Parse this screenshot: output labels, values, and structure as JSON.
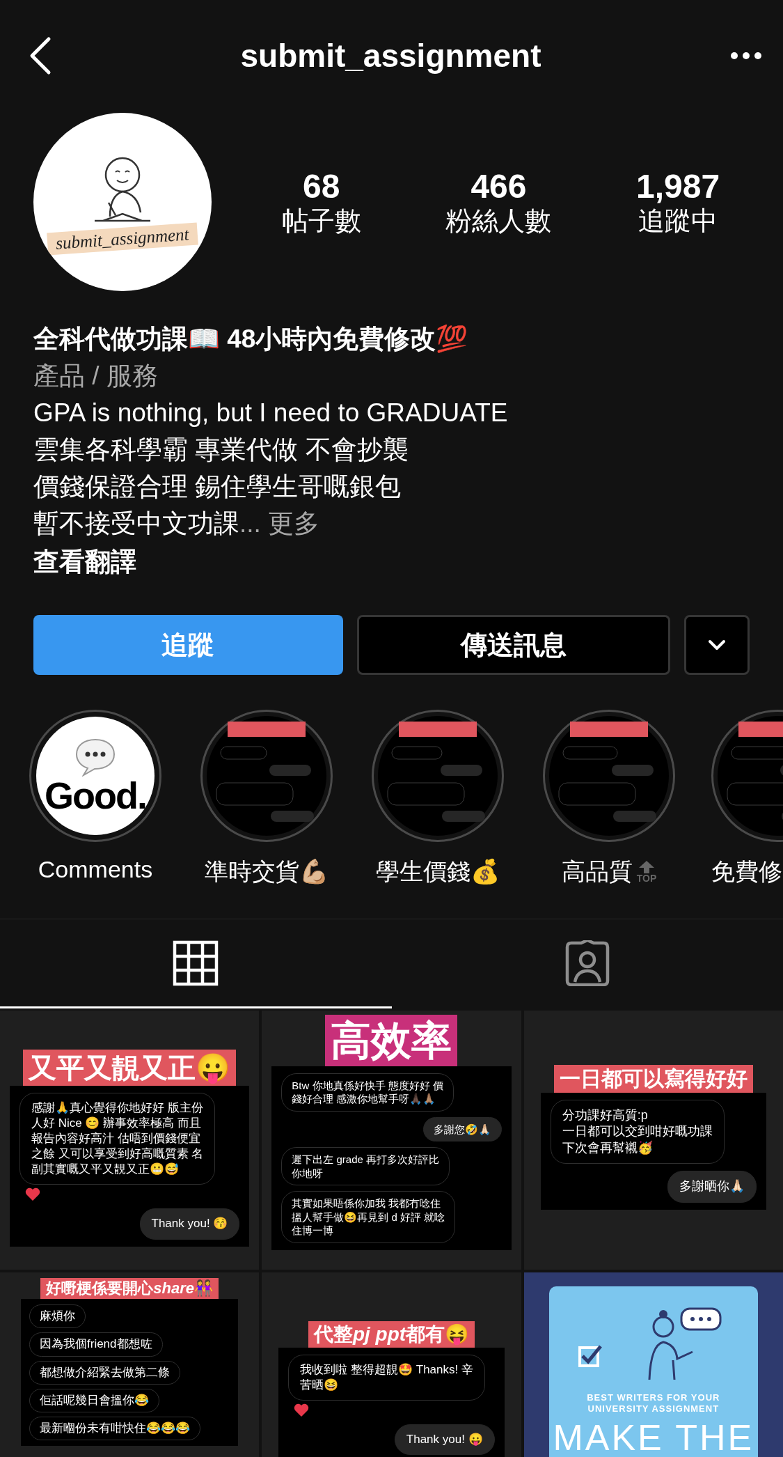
{
  "header": {
    "title": "submit_assignment"
  },
  "profile": {
    "avatar_text": "submit_assignment",
    "stats": [
      {
        "value": "68",
        "label": "帖子數"
      },
      {
        "value": "466",
        "label": "粉絲人數"
      },
      {
        "value": "1,987",
        "label": "追蹤中"
      }
    ]
  },
  "bio": {
    "name": "全科代做功課📖 48小時內免費修改💯",
    "category": "產品 / 服務",
    "lines": [
      "GPA is nothing, but I need to GRADUATE",
      "雲集各科學霸 專業代做 不會抄襲",
      "價錢保證合理 錫住學生哥嘅銀包",
      "暫不接受中文功課"
    ],
    "ellipsis": "...",
    "more": "更多",
    "translate": "查看翻譯"
  },
  "buttons": {
    "follow": "追蹤",
    "message": "傳送訊息"
  },
  "highlights": [
    {
      "kind": "good",
      "cover_text": "Good.",
      "label": "Comments"
    },
    {
      "kind": "chat",
      "label": "準時交貨💪🏼"
    },
    {
      "kind": "chat",
      "label": "學生價錢💰"
    },
    {
      "kind": "chat",
      "label": "高品質",
      "badge": "TOP"
    },
    {
      "kind": "chat",
      "label": "免費修"
    }
  ],
  "tabs": [
    {
      "kind": "grid",
      "selected": true
    },
    {
      "kind": "tagged",
      "selected": false
    }
  ],
  "posts": [
    {
      "kind": "chat",
      "banner": "又平又靚又正😛",
      "color": "#e0565e",
      "messages": [
        {
          "kind": "incoming",
          "lines": [
            "感謝🙏真心覺得你地好好 版主份",
            "人好 Nice 😊 辦事效率極高 而且",
            "報告內容好高汁 估唔到價錢便宜",
            "之餘 又可以享受到好高嘅質素 名",
            "副其實嘅又平又靚又正😬😅"
          ],
          "reaction": true
        },
        {
          "kind": "outgoing",
          "lines": [
            "Thank you! 😚"
          ],
          "reaction": false
        }
      ]
    },
    {
      "kind": "chat",
      "banner": "高效率",
      "color": "#c8307a",
      "messages": [
        {
          "kind": "incoming",
          "lines": [
            "Btw 你地真係好快手 態度好好 價",
            "錢好合理 感激你地幫手呀🙏🏿🙏🏽"
          ],
          "reaction": false
        },
        {
          "kind": "outgoing",
          "lines": [
            "多謝您🤣🙏🏻"
          ],
          "reaction": false
        },
        {
          "kind": "incoming",
          "lines": [
            "遲下出左 grade 再打多次好評比",
            "你地呀"
          ],
          "reaction": false
        },
        {
          "kind": "incoming",
          "lines": [
            "其實如果唔係你加我 我都冇唸住",
            "搵人幫手做😆再見到 d 好評 就唸",
            "住博一博"
          ],
          "reaction": false
        }
      ]
    },
    {
      "kind": "chat",
      "banner": "一日都可以寫得好好",
      "color": "#e0565e",
      "messages": [
        {
          "kind": "incoming",
          "lines": [
            "分功課好高質:p",
            "一日都可以交到咁好嘅功課",
            "下次會再幫襯🥳"
          ],
          "reaction": false
        },
        {
          "kind": "outgoing",
          "lines": [
            "多謝晒你🙏🏻"
          ],
          "reaction": false
        }
      ]
    },
    {
      "kind": "chat",
      "banner": "好嘢梗係要開心**share**👭",
      "color": "#e0565e",
      "messages": [
        {
          "kind": "incoming",
          "lines": [
            "麻煩你"
          ],
          "reaction": false
        },
        {
          "kind": "incoming",
          "lines": [
            "因為我個friend都想咗"
          ],
          "reaction": false
        },
        {
          "kind": "incoming",
          "lines": [
            "都想做介紹緊去做第二條"
          ],
          "reaction": false
        },
        {
          "kind": "incoming",
          "lines": [
            "佢話呢幾日會搵你😂"
          ],
          "reaction": false
        },
        {
          "kind": "incoming",
          "lines": [
            "最新嗰份未有咁快住😂😂😂"
          ],
          "reaction": false
        }
      ]
    },
    {
      "kind": "chat",
      "banner": "代整**pj ppt**都有😝",
      "color": "#e0565e",
      "messages": [
        {
          "kind": "incoming",
          "lines": [
            "我收到啦 整得超靚🤩 Thanks! 辛",
            "苦晒😆"
          ],
          "reaction": true
        },
        {
          "kind": "outgoing",
          "lines": [
            "Thank you! 😛"
          ],
          "reaction": false
        }
      ]
    },
    {
      "kind": "poster",
      "subtitle": "BEST WRITERS FOR YOUR UNIVERSITY ASSIGNMENT",
      "headline": "MAKE THE"
    }
  ]
}
